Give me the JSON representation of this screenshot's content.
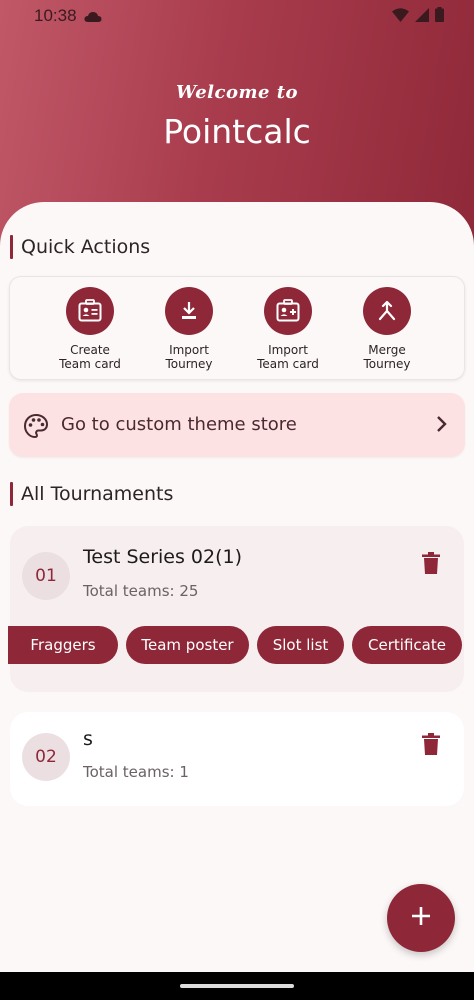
{
  "status": {
    "time": "10:38"
  },
  "header": {
    "welcome": "Welcome to",
    "title": "Pointcalc"
  },
  "quick_actions": {
    "heading": "Quick Actions",
    "items": [
      {
        "line1": "Create",
        "line2": "Team card",
        "icon": "id-card-icon"
      },
      {
        "line1": "Import",
        "line2": "Tourney",
        "icon": "download-icon"
      },
      {
        "line1": "Import",
        "line2": "Team card",
        "icon": "id-card-plus-icon"
      },
      {
        "line1": "Merge",
        "line2": "Tourney",
        "icon": "merge-icon"
      }
    ]
  },
  "theme_store": {
    "label": "Go to custom theme store",
    "icon": "palette-icon"
  },
  "tournaments": {
    "heading": "All Tournaments",
    "items": [
      {
        "number": "01",
        "name": "Test Series 02(1)",
        "teams": "Total teams: 25",
        "actions": [
          "Fraggers",
          "Team poster",
          "Slot list",
          "Certificate"
        ]
      },
      {
        "number": "02",
        "name": "s",
        "teams": "Total teams: 1"
      }
    ]
  },
  "colors": {
    "accent": "#8e2838",
    "header_start": "#c05868",
    "header_end": "#8e2838",
    "banner": "#fde2e3"
  }
}
